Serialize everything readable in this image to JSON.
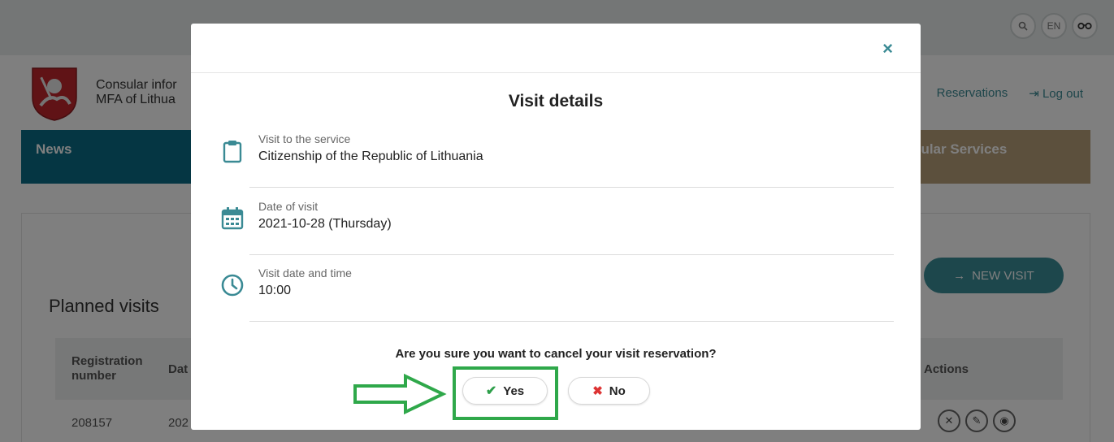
{
  "top_icons": {
    "search_icon": "search-icon",
    "language": "EN",
    "glasses_icon": "glasses-icon"
  },
  "header": {
    "org_line1": "Consular infor",
    "org_line2": "MFA of Lithua",
    "reservations_label": "Reservations",
    "logout_label": "Log out"
  },
  "nav": {
    "news_label": "News",
    "consular_label": "sular Services"
  },
  "page": {
    "planned_visits_title": "Planned visits",
    "new_visit_label": "NEW VISIT",
    "columns": {
      "registration": "Registration number",
      "date_partial": "Dat",
      "actions": "Actions"
    },
    "row": {
      "registration": "208157",
      "date_partial": "202"
    }
  },
  "modal": {
    "close_symbol": "×",
    "title": "Visit details",
    "fields": [
      {
        "label": "Visit to the service",
        "value": "Citizenship of the Republic of Lithuania",
        "icon": "clipboard-icon"
      },
      {
        "label": "Date of visit",
        "value": "2021-10-28 (Thursday)",
        "icon": "calendar-icon"
      },
      {
        "label": "Visit date and time",
        "value": "10:00",
        "icon": "clock-icon"
      }
    ],
    "question": "Are you sure you want to cancel your visit reservation?",
    "yes_label": "Yes",
    "no_label": "No"
  },
  "colors": {
    "accent": "#3a8a94",
    "highlight": "#2fa84a",
    "nav": "#0b6d86"
  }
}
